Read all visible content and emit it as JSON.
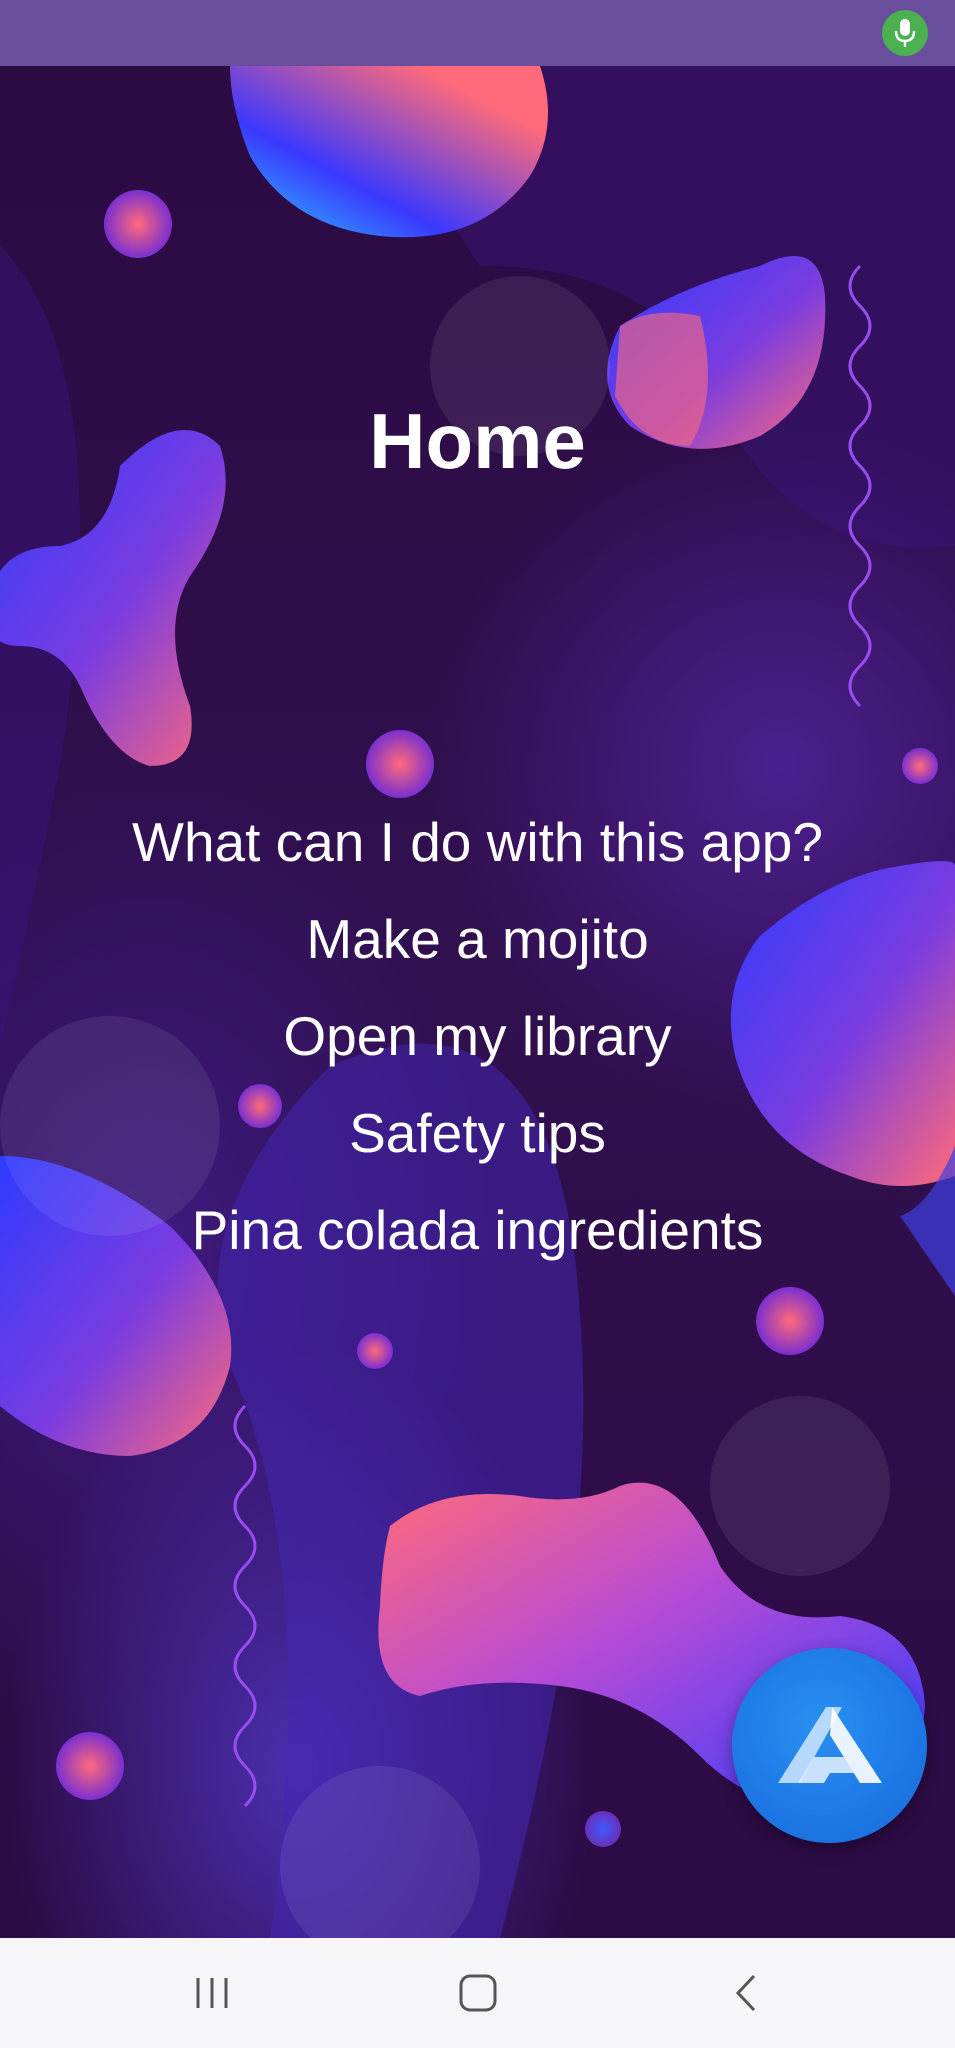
{
  "status_bar": {
    "mic_icon": "microphone-icon",
    "mic_color": "#4caf50"
  },
  "screen": {
    "title": "Home",
    "commands": [
      "What can I do with this app?",
      "Make a mojito",
      "Open my library",
      "Safety tips",
      "Pina colada ingredients"
    ]
  },
  "assistant_button": {
    "icon": "assistant-a-logo-icon",
    "color": "#1d78e6"
  },
  "navigation_bar": {
    "recent_icon": "recent-apps-icon",
    "home_icon": "home-icon",
    "back_icon": "back-icon"
  },
  "colors": {
    "background": "#2c0a42",
    "status_bar": "#6a4e9e",
    "text": "#ffffff"
  }
}
